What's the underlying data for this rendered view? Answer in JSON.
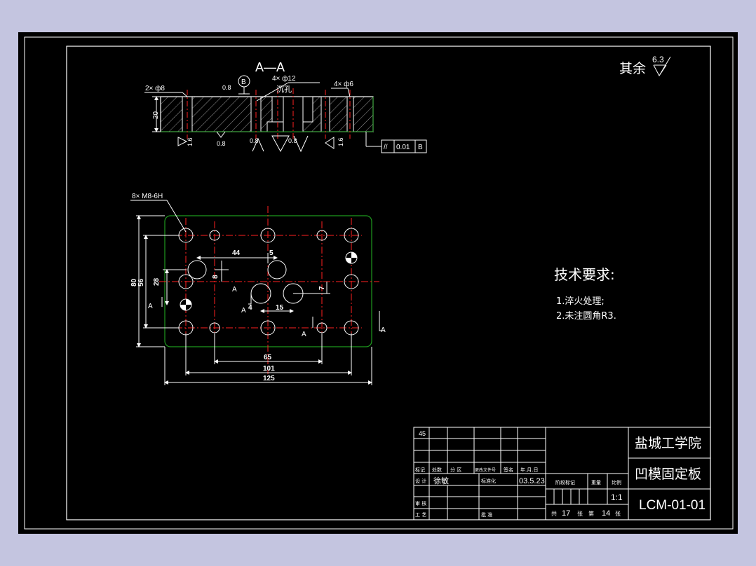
{
  "colors": {
    "background": "#c4c5e0",
    "sheet": "#000000",
    "line_white": "#ffffff",
    "center_red": "#ff2020",
    "outline_green": "#1e9a1e",
    "hatch_gray": "#bfbfbf"
  },
  "section": {
    "title": "A—A",
    "roughness_note": "其余",
    "roughness_value": "6.3",
    "callout_holes_left": "2× ф8",
    "callout_holes_center": "4× ф12",
    "callout_counterbore": "沉孔",
    "callout_holes_right": "4× ф6",
    "height_dim": "20",
    "datum_label": "B",
    "rough_08": "0.8",
    "rough_16": "1.6",
    "parallel_symbol": "//",
    "parallel_tol": "0.01",
    "parallel_datum": "B"
  },
  "plan": {
    "thread_callout": "8× M8-6H",
    "dim_44": "44",
    "dim_5": "5",
    "dim_8": "8",
    "dim_28": "28",
    "dim_7": "7",
    "dim_4": "4",
    "dim_15": "15",
    "dim_80": "80",
    "dim_56": "56",
    "dim_65": "65",
    "dim_101": "101",
    "dim_125": "125",
    "section_mark": "A"
  },
  "notes": {
    "title": "技术要求:",
    "item1": "1.淬火处理;",
    "item2": "2.未注圆角R3."
  },
  "title_block": {
    "material": "45",
    "hdr_mark": "标记",
    "hdr_count": "处数",
    "hdr_zone": "分 区",
    "hdr_docno": "更改文件号",
    "hdr_sign": "签名",
    "hdr_date": "年.月.日",
    "lbl_design": "设 计",
    "designer": "徐敏",
    "lbl_standard": "标准化",
    "date": "03.5.23",
    "lbl_stage": "阶段标记",
    "lbl_weight": "重量",
    "lbl_scale": "比例",
    "scale": "1:1",
    "lbl_review": "审 核",
    "lbl_process": "工 艺",
    "lbl_approve": "批 准",
    "sheets_total_label": "共",
    "sheets_total": "17",
    "sheets_word": "张",
    "sheet_no_label": "第",
    "sheet_no": "14",
    "school": "盐城工学院",
    "part_name": "凹模固定板",
    "drawing_no": "LCM-01-01"
  }
}
